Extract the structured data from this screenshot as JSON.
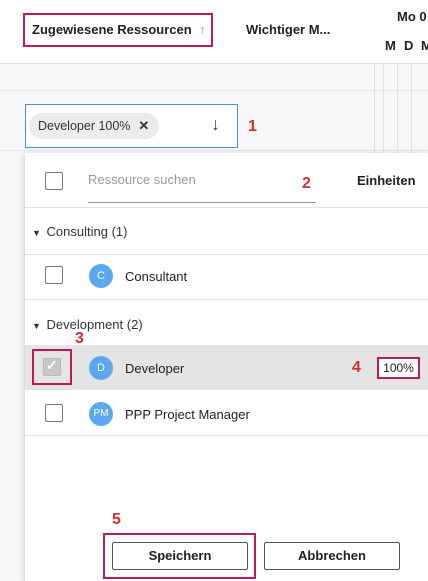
{
  "header": {
    "col_resources": "Zugewiesene Ressourcen",
    "col_important": "Wichtiger M...",
    "day_label": "Mo 0",
    "weekdays": [
      "M",
      "D",
      "M"
    ]
  },
  "selector": {
    "chip_label": "Developer 100%"
  },
  "dropdown": {
    "search_placeholder": "Ressource suchen",
    "units_label": "Einheiten",
    "groups": [
      {
        "label": "Consulting (1)",
        "items": [
          {
            "avatar": "C",
            "name": "Consultant",
            "checked": false
          }
        ]
      },
      {
        "label": "Development (2)",
        "items": [
          {
            "avatar": "D",
            "name": "Developer",
            "checked": true,
            "units": "100%"
          },
          {
            "avatar": "PM",
            "name": "PPP Project Manager",
            "checked": false
          }
        ]
      }
    ],
    "save_label": "Speichern",
    "cancel_label": "Abbrechen"
  },
  "callouts": {
    "n1": "1",
    "n2": "2",
    "n3": "3",
    "n4": "4",
    "n5": "5"
  },
  "colors": {
    "accent": "#c2185b",
    "callout": "#d32f2f",
    "avatar": "#5aa9f0",
    "focus": "#4a90d9"
  }
}
